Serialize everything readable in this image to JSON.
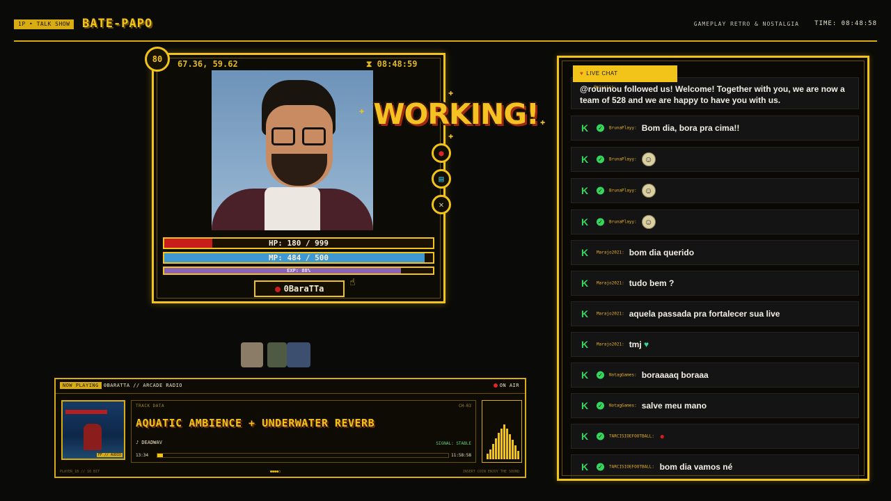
{
  "header": {
    "tag": "1P • TALK SHOW",
    "brand": "BATE-PAPO",
    "subtitle": "GAMEPLAY RETRO & NOSTALGIA",
    "clock": "TIME: 08:48:58"
  },
  "player": {
    "level": "80",
    "coords": "67.36, 59.62",
    "timer": "08:48:59",
    "status_banner": "WORKING!",
    "hp": {
      "label": "HP: 180 / 999",
      "fraction": 0.18
    },
    "mp": {
      "label": "MP: 484 / 500",
      "fraction": 0.968
    },
    "exp": {
      "label": "EXP: 88%",
      "fraction": 0.88
    },
    "name": "0BaraTTa"
  },
  "radio": {
    "now_playing_label": "NOW PLAYING",
    "station": "0BARATTA // ARCADE RADIO",
    "on_air": "ON AIR",
    "track_data_label": "TRACK DATA",
    "channel": "CH-03",
    "title": "AQUATIC AMBIENCE + UNDERWATER REVERB",
    "artist": "♪ DEADWAV",
    "signal": "SIGNAL: STABLE",
    "time_elapsed": "13:34",
    "time_total": "11:58:58",
    "progress": 0.02,
    "cover_tag": "FF // AUDIO",
    "footer_left": "PLAYER_1B // 16 BIT",
    "footer_center": "●●●●○",
    "footer_right": "INSERT COIN    ENJOY THE SOUND"
  },
  "chat": {
    "tab_label": "LIVE CHAT",
    "messages": [
      {
        "user": "@mississ:",
        "text": "@rounnou followed us! Welcome! Together with you, we are now a team of 528 and we are happy to have you with us.",
        "verified": true
      },
      {
        "user": "BrunaPlayy:",
        "text": "Bom dia, bora pra cima!!",
        "verified": true
      },
      {
        "user": "BrunaPlayy:",
        "text": "",
        "emoji": "smile",
        "verified": true
      },
      {
        "user": "BrunaPlayy:",
        "text": "",
        "emoji": "smile",
        "verified": true
      },
      {
        "user": "BrunaPlayy:",
        "text": "",
        "emoji": "smile",
        "verified": true
      },
      {
        "user": "Marajo2021:",
        "text": "bom dia querido",
        "verified": false
      },
      {
        "user": "Marajo2021:",
        "text": "tudo bem ?",
        "verified": false
      },
      {
        "user": "Marajo2021:",
        "text": "aquela passada pra fortalecer sua live",
        "verified": false
      },
      {
        "user": "Marajo2021:",
        "text": "tmj",
        "emoji": "heart",
        "verified": false
      },
      {
        "user": "NotagGames:",
        "text": "boraaaaq boraaa",
        "verified": true
      },
      {
        "user": "NotagGames:",
        "text": "salve meu mano",
        "verified": true
      },
      {
        "user": "TARCISIOEFOOTBALL:",
        "text": "",
        "emoji": "glove",
        "verified": true
      },
      {
        "user": "TARCISIOEFOOTBALL:",
        "text": "bom dia vamos né",
        "verified": true
      }
    ]
  },
  "colors": {
    "accent": "#f2c318",
    "hp": "#c81d1d",
    "mp": "#3f98d2",
    "exp": "#8a63b8",
    "kick_green": "#35d65c"
  }
}
